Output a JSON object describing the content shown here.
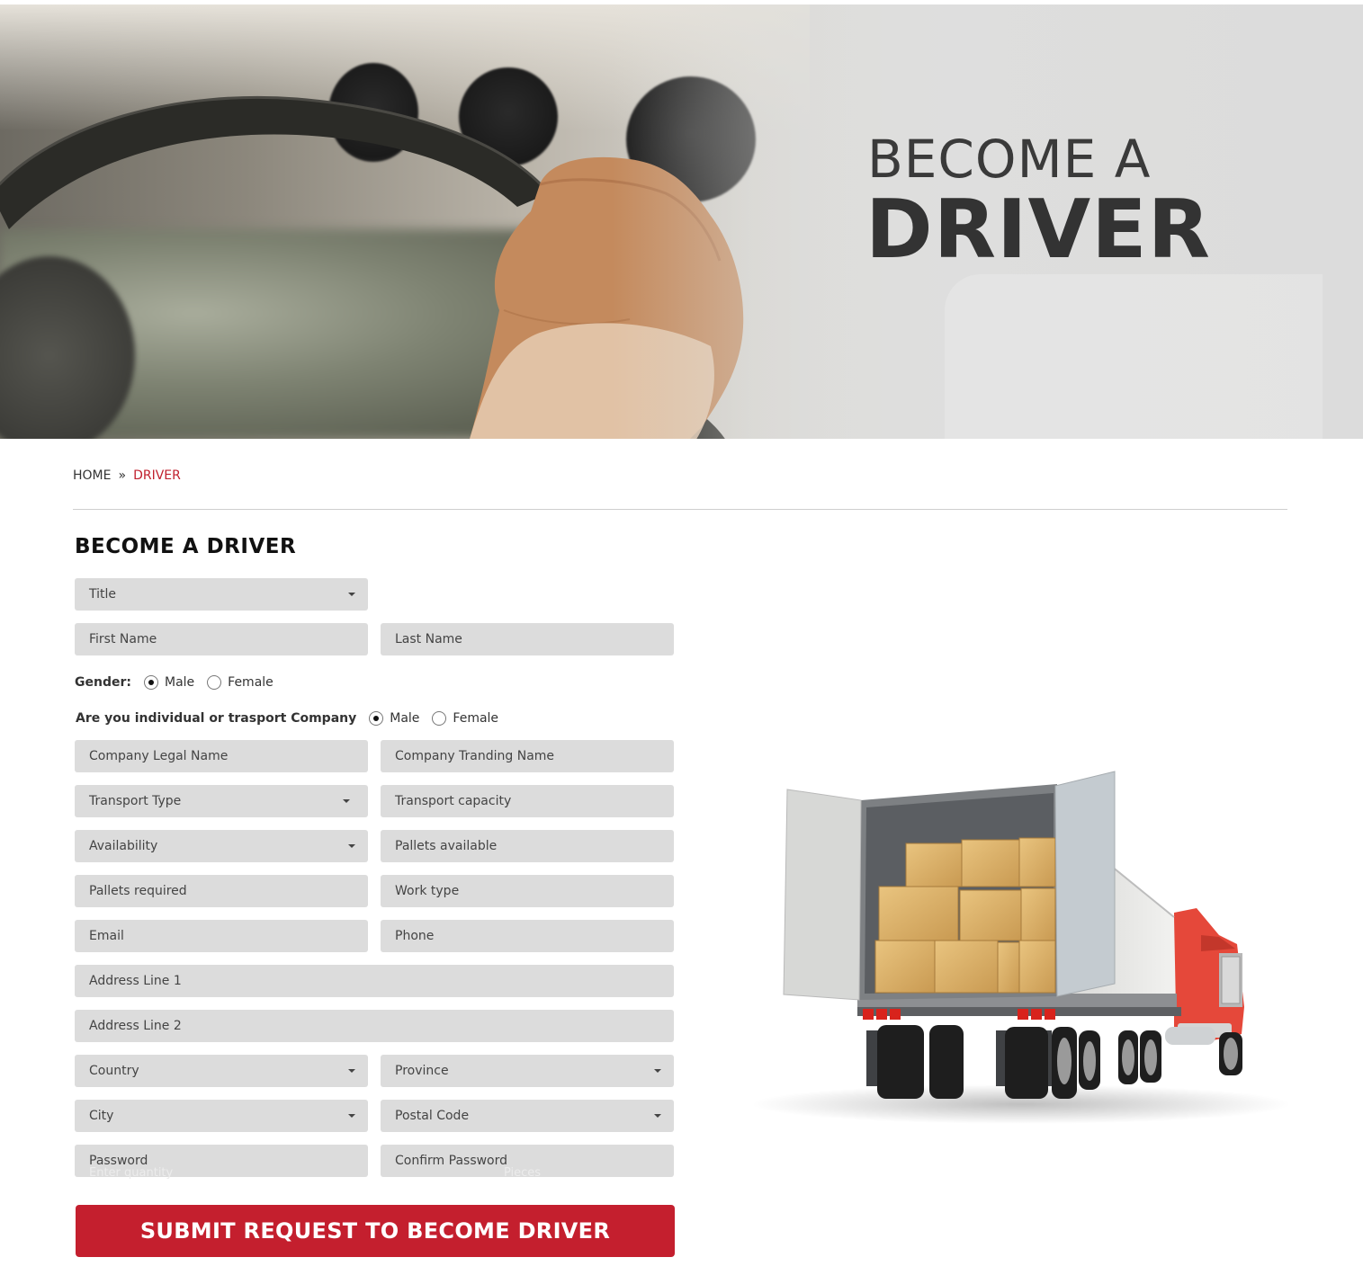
{
  "hero": {
    "line1": "BECOME A",
    "line2": "DRIVER"
  },
  "breadcrumb": {
    "home": "HOME",
    "separator": "»",
    "current": "DRIVER"
  },
  "form": {
    "title": "BECOME A DRIVER",
    "title_select": "Title",
    "first_name": "First Name",
    "last_name": "Last Name",
    "gender_label": "Gender:",
    "gender_option_1": "Male",
    "gender_option_2": "Female",
    "company_question": "Are you individual or trasport Company",
    "company_option_1": "Male",
    "company_option_2": "Female",
    "company_legal_name": "Company Legal Name",
    "company_trading_name": "Company Tranding Name",
    "transport_type": "Transport Type",
    "transport_capacity": "Transport capacity",
    "availability": "Availability",
    "pallets_available": "Pallets available",
    "pallets_required": "Pallets required",
    "work_type": "Work type",
    "email": "Email",
    "phone": "Phone",
    "address_1": "Address Line 1",
    "address_2": "Address Line 2",
    "country": "Country",
    "province": "Province",
    "city": "City",
    "postal_code": "Postal Code",
    "password": "Password",
    "confirm_password": "Confirm Password",
    "ghost_quantity": "Enter quantity",
    "ghost_pieces": "Pieces",
    "submit": "SUBMIT REQUEST TO BECOME DRIVER"
  },
  "colors": {
    "accent": "#c41f2e",
    "field_bg": "#dcdcdc"
  }
}
